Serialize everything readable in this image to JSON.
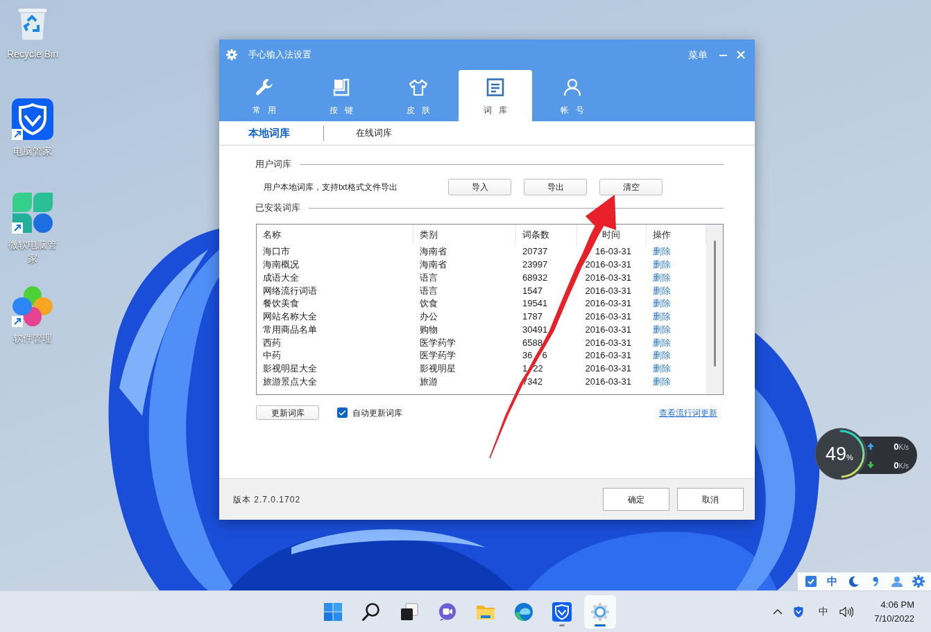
{
  "desktop_icons": [
    {
      "label": "Recycle Bin",
      "shortcut": false
    },
    {
      "label": "电脑管家",
      "shortcut": true
    },
    {
      "label": "微软电脑管家",
      "shortcut": true
    },
    {
      "label": "软件管理",
      "shortcut": true
    }
  ],
  "window": {
    "title": "手心输入法设置",
    "menu": "菜单"
  },
  "tabs": [
    {
      "label": "常用",
      "selected": false
    },
    {
      "label": "按键",
      "selected": false
    },
    {
      "label": "皮肤",
      "selected": false
    },
    {
      "label": "词库",
      "selected": true
    },
    {
      "label": "帐号",
      "selected": false
    }
  ],
  "subtabs": [
    {
      "label": "本地词库",
      "selected": true
    },
    {
      "label": "在线词库",
      "selected": false
    }
  ],
  "user_dictionary": {
    "heading": "用户词库",
    "description": "用户本地词库，支持txt格式文件导出",
    "buttons": [
      "导入",
      "导出",
      "清空"
    ]
  },
  "installed_dictionaries": {
    "heading": "已安装词库",
    "table": {
      "columns": [
        "名称",
        "类别",
        "词条数",
        "时间",
        "操作"
      ],
      "rows": [
        [
          "海口市",
          "海南省",
          "20737",
          "16-03-31",
          "删除"
        ],
        [
          "海南概况",
          "海南省",
          "23997",
          "2016-03-31",
          "删除"
        ],
        [
          "成语大全",
          "语言",
          "68932",
          "2016-03-31",
          "删除"
        ],
        [
          "网络流行词语",
          "语言",
          "1547",
          "2016-03-31",
          "删除"
        ],
        [
          "餐饮美食",
          "饮食",
          "19541",
          "2016-03-31",
          "删除"
        ],
        [
          "网站名称大全",
          "办公",
          "1787",
          "2016-03-31",
          "删除"
        ],
        [
          "常用商品名单",
          "购物",
          "30491",
          "2016-03-31",
          "删除"
        ],
        [
          "西药",
          "医学药学",
          "6588",
          "2016-03-31",
          "删除"
        ],
        [
          "中药",
          "医学药学",
          [
            "36",
            "6"
          ],
          "2016-03-31",
          "删除"
        ],
        [
          "影视明星大全",
          "影视明星",
          [
            "1",
            "22"
          ],
          "2016-03-31",
          "删除"
        ],
        [
          "旅游景点大全",
          "旅游",
          "7342",
          "2016-03-31",
          "删除"
        ]
      ]
    },
    "update_button": "更新词库",
    "auto_update": {
      "label": "自动更新词库",
      "checked": true
    },
    "link": "查看流行词更新"
  },
  "footer": {
    "version": "版本 2.7.0.1702",
    "buttons": [
      "确定",
      "取消"
    ]
  },
  "network_widget": {
    "percent": "49",
    "percent_sign": "%",
    "level": 0.49,
    "rates": [
      {
        "kind": "upload",
        "value": "0",
        "unit": "K/s"
      },
      {
        "kind": "download",
        "value": "0",
        "unit": "K/s"
      }
    ]
  },
  "ime_bar": {
    "mode": "中"
  },
  "taskbar": {
    "apps": [
      {
        "active": false,
        "running": false
      },
      {
        "active": false,
        "running": false
      },
      {
        "active": false,
        "running": false
      },
      {
        "active": false,
        "running": false
      },
      {
        "active": false,
        "running": false
      },
      {
        "active": false,
        "running": false
      },
      {
        "active": false,
        "running": true
      },
      {
        "active": true,
        "running": false
      }
    ],
    "tray": {
      "ime": "中",
      "time": "4:06 PM",
      "date": "7/10/2022"
    }
  }
}
